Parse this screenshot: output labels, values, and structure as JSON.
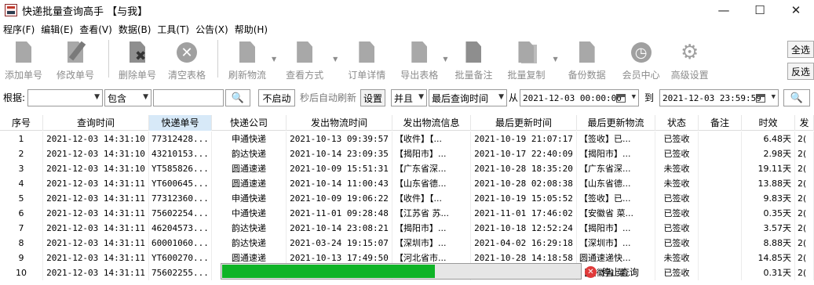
{
  "window": {
    "title": "快递批量查询高手 【与我】",
    "minimize": "—",
    "maximize": "☐",
    "close": "✕"
  },
  "menu": [
    {
      "label": "程序(F)"
    },
    {
      "label": "编辑(E)"
    },
    {
      "label": "查看(V)"
    },
    {
      "label": "数据(B)"
    },
    {
      "label": "工具(T)"
    },
    {
      "label": "公告(X)"
    },
    {
      "label": "帮助(H)"
    }
  ],
  "toolbar": {
    "add": "添加单号",
    "edit": "修改单号",
    "delete": "删除单号",
    "clear": "清空表格",
    "refresh": "刷新物流",
    "view_mode": "查看方式",
    "order_detail": "订单详情",
    "export": "导出表格",
    "batch_note": "批量备注",
    "batch_copy": "批量复制",
    "backup": "备份数据",
    "member": "会员中心",
    "advanced": "高级设置",
    "select_all": "全选",
    "invert": "反选"
  },
  "filter": {
    "basis_label": "根据:",
    "basis_value": "",
    "match_value": "包含",
    "keyword": "",
    "auto_refresh_state": "不启动",
    "auto_refresh_label": "秒后自动刷新",
    "settings": "设置",
    "logic": "并且",
    "time_field": "最后查询时间",
    "from_label": "从",
    "from_value": "2021-12-03 00:00:00",
    "to_label": "到",
    "to_value": "2021-12-03 23:59:59"
  },
  "table": {
    "columns": [
      "序号",
      "查询时间",
      "快递单号",
      "快递公司",
      "发出物流时间",
      "发出物流信息",
      "最后更新时间",
      "最后更新物流",
      "状态",
      "备注",
      "时效",
      "发"
    ],
    "rows": [
      [
        "1",
        "2021-12-03 14:31:10",
        "77312428...",
        "申通快递",
        "2021-10-13 09:39:57",
        "【收件】【...",
        "2021-10-19 21:07:17",
        "【签收】已...",
        "已签收",
        "",
        "6.48天",
        "2("
      ],
      [
        "2",
        "2021-12-03 14:31:10",
        "43210153...",
        "韵达快递",
        "2021-10-14 23:09:35",
        "【揭阳市】...",
        "2021-10-17 22:40:09",
        "【揭阳市】...",
        "已签收",
        "",
        "2.98天",
        "2("
      ],
      [
        "3",
        "2021-12-03 14:31:10",
        "YT585826...",
        "圆通速递",
        "2021-10-09 15:51:31",
        "【广东省深...",
        "2021-10-28 18:35:20",
        "【广东省深...",
        "未签收",
        "",
        "19.11天",
        "2("
      ],
      [
        "4",
        "2021-12-03 14:31:11",
        "YT600645...",
        "圆通速递",
        "2021-10-14 11:00:43",
        "【山东省德...",
        "2021-10-28 02:08:38",
        "【山东省德...",
        "未签收",
        "",
        "13.88天",
        "2("
      ],
      [
        "5",
        "2021-12-03 14:31:11",
        "77312360...",
        "申通快递",
        "2021-10-09 19:06:22",
        "【收件】【...",
        "2021-10-19 15:05:52",
        "【签收】已...",
        "已签收",
        "",
        "9.83天",
        "2("
      ],
      [
        "6",
        "2021-12-03 14:31:11",
        "75602254...",
        "中通快递",
        "2021-11-01 09:28:48",
        "【江苏省 苏...",
        "2021-11-01 17:46:02",
        "【安徽省 菜...",
        "已签收",
        "",
        "0.35天",
        "2("
      ],
      [
        "7",
        "2021-12-03 14:31:11",
        "46204573...",
        "韵达快递",
        "2021-10-14 23:08:21",
        "【揭阳市】...",
        "2021-10-18 12:52:24",
        "【揭阳市】...",
        "已签收",
        "",
        "3.57天",
        "2("
      ],
      [
        "8",
        "2021-12-03 14:31:11",
        "60001060...",
        "韵达快递",
        "2021-03-24 19:15:07",
        "【深圳市】...",
        "2021-04-02 16:29:18",
        "【深圳市】...",
        "已签收",
        "",
        "8.88天",
        "2("
      ],
      [
        "9",
        "2021-12-03 14:31:11",
        "YT600270...",
        "圆通速递",
        "2021-10-13 17:49:50",
        "【河北省市...",
        "2021-10-28 14:18:58",
        "圆通速递快...",
        "未签收",
        "",
        "14.85天",
        "2("
      ],
      [
        "10",
        "2021-12-03 14:31:11",
        "75602255...",
        "中通快递",
        "2021-11-01 09:28:48",
        "【江苏省 苏...",
        "2021-11-01 17:00:34",
        "【安徽省 菜...",
        "已签收",
        "",
        "0.31天",
        "2("
      ]
    ]
  },
  "progress": {
    "fraction": 0.595,
    "stop_label": "停止查询",
    "fill_color": "#0fb427"
  }
}
